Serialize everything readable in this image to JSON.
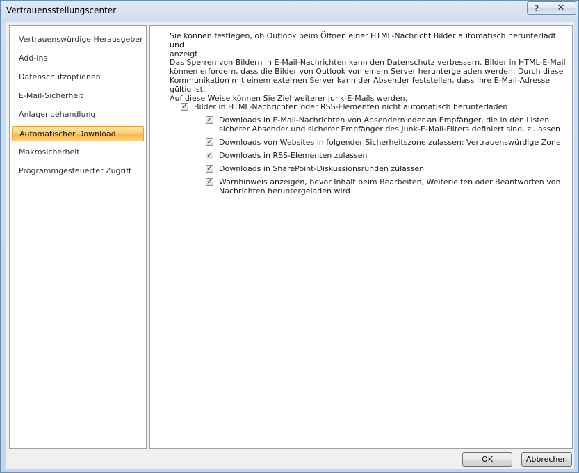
{
  "window": {
    "title": "Vertrauensstellungscenter",
    "help_glyph": "?",
    "close_glyph": "✕"
  },
  "sidebar": {
    "items": [
      {
        "label": "Vertrauenswürdige Herausgeber",
        "selected": false
      },
      {
        "label": "Add-Ins",
        "selected": false
      },
      {
        "label": "Datenschutzoptionen",
        "selected": false
      },
      {
        "label": "E-Mail-Sicherheit",
        "selected": false
      },
      {
        "label": "Anlagenbehandlung",
        "selected": false
      },
      {
        "label": "Automatischer Download",
        "selected": true
      },
      {
        "label": "Makrosicherheit",
        "selected": false
      },
      {
        "label": "Programmgesteuerter Zugriff",
        "selected": false
      }
    ]
  },
  "content": {
    "intro": "Sie können festlegen, ob Outlook beim Öffnen einer HTML-Nachricht Bilder automatisch herunterlädt und\nanzeigt.",
    "privacy_note": "Das Sperren von Bildern in E-Mail-Nachrichten kann den Datenschutz verbessern. Bilder in HTML-E-Mail\nkönnen erfordern, dass die Bilder von Outlook von einem Server heruntergeladen werden. Durch diese\nKommunikation mit einem externen Server kann der Absender feststellen, dass Ihre E-Mail-Adresse gültig ist.\nAuf diese Weise können Sie Ziel weiterer Junk-E-Mails werden.",
    "main_option": {
      "label": "Bilder in HTML-Nachrichten oder RSS-Elementen nicht automatisch herunterladen",
      "checked": true
    },
    "sub_options": [
      {
        "label": "Downloads in E-Mail-Nachrichten von Absendern oder an Empfänger, die in den Listen\nsicherer Absender und sicherer Empfänger des Junk-E-Mail-Filters definiert sind, zulassen",
        "checked": true
      },
      {
        "label": "Downloads von Websites in folgender Sicherheitszone zulassen: Vertrauenswürdige Zone",
        "checked": true
      },
      {
        "label": "Downloads in RSS-Elementen zulassen",
        "checked": true
      },
      {
        "label": "Downloads in SharePoint-Diskussionsrunden zulassen",
        "checked": true
      },
      {
        "label": "Warnhinweis anzeigen, bevor Inhalt beim Bearbeiten, Weiterleiten oder Beantworten von\nNachrichten heruntergeladen wird",
        "checked": true
      }
    ],
    "check_glyph": "✓"
  },
  "buttons": {
    "ok": "OK",
    "cancel": "Abbrechen"
  }
}
